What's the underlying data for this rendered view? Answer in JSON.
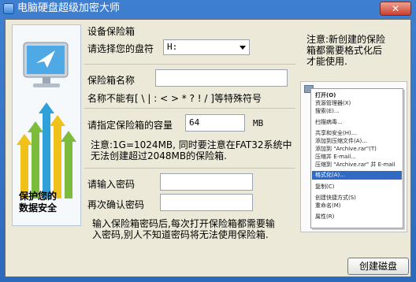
{
  "window": {
    "title": "电脑硬盘超级加密大师",
    "close_label": "✕"
  },
  "left_panel": {
    "slogan_line1": "保护您的",
    "slogan_line2": "数据安全"
  },
  "setup": {
    "section_title": "设备保险箱",
    "drive_label": "请选择您的盘符",
    "drive_value": "H:"
  },
  "name_section": {
    "label": "保险箱名称",
    "value": "",
    "restriction": "名称不能有[ \\ | : < > * ? ! / ]等特殊符号"
  },
  "capacity": {
    "label": "请指定保险箱的容量",
    "value": "64",
    "unit": "MB",
    "note_line1": "注意:1G=1024MB, 同时要注意在FAT32系统中",
    "note_line2": "无法创建超过2048MB的保险箱."
  },
  "password": {
    "label": "请输入密码",
    "confirm_label": "再次确认密码",
    "value": "",
    "confirm_value": "",
    "note_line1": "输入保险箱密码后,每次打开保险箱都需要输",
    "note_line2": "入密码,别人不知道密码将无法使用保险箱."
  },
  "right_note": {
    "line1": "注意:新创建的保险",
    "line2": "箱都需要格式化后",
    "line3": "才能使用."
  },
  "context_menu": {
    "items": [
      {
        "label": "打开(O)",
        "bold": true
      },
      {
        "label": "资源管理器(X)"
      },
      {
        "label": "搜索(E)..."
      },
      {
        "label": "扫描病毒..."
      },
      {
        "label": "共享和安全(H)..."
      },
      {
        "label": "添加到压缩文件(A)..."
      },
      {
        "label": "添加到 \"Archive.rar\"(T)"
      },
      {
        "label": "压缩并 E-mail..."
      },
      {
        "label": "压缩到 \"Archive.rar\" 并 E-mail"
      },
      {
        "label": "格式化(A)...",
        "highlighted": true
      },
      {
        "label": "复制(C)"
      },
      {
        "label": "创建快捷方式(S)"
      },
      {
        "label": "重命名(M)"
      },
      {
        "label": "属性(R)"
      }
    ]
  },
  "buttons": {
    "create": "创建磁盘"
  },
  "colors": {
    "title_bar": "#2b69bd",
    "client_bg": "#ece9d8",
    "menu_highlight": "#316ac5"
  }
}
